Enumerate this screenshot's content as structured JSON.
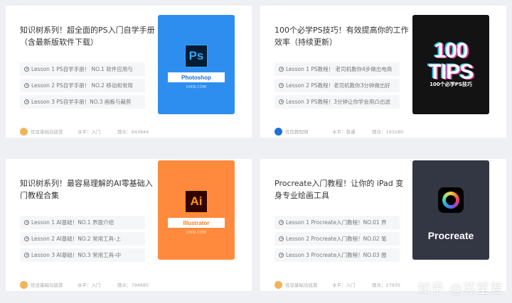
{
  "watermark": "知乎 @苏笙君",
  "colors": {
    "accent_blue": "#2e8ef0",
    "accent_orange": "#ff8a3d",
    "page_bg": "#eef0f3"
  },
  "cards": [
    {
      "title": "知识树系列！超全面的PS入门自学手册（含最新版软件下载）",
      "lessons": [
        "Lesson 1 PS自学手册！ NO.1 软件应用与",
        "Lesson 2 PS自学手册！ NO.2 移动和常用",
        "Lesson 3 PS自学手册！NO.3 画板与裁剪"
      ],
      "author": "优设基础功底营",
      "level": "水平：入门",
      "views": "观众：943844",
      "cover": {
        "brand": "Photoshop",
        "icon_text": "Ps",
        "sub": "UIKN.COM",
        "icon": "photoshop-icon"
      }
    },
    {
      "title": "100个必学PS技巧！有效提高你的工作效率（持续更新）",
      "lessons": [
        "Lesson 1 PS教程！ 老司机教你4步做出电商",
        "Lesson 2 PS教程！老司机教你3分钟做出好",
        "Lesson 3 PS教程！3分钟让你学会用凸出滤"
      ],
      "author": "优优教程网",
      "level": "水平：普通",
      "views": "观众：193280",
      "cover": {
        "big": "100 TIPS",
        "sub": "100个必学PS技巧"
      }
    },
    {
      "title": "知识树系列！最容易理解的AI零基础入门教程合集",
      "lessons": [
        "Lesson 1 AI基础！NO.1 界面介绍",
        "Lesson 2 AI基础！NO.2 常用工具-上",
        "Lesson 3 AI基础！NO.3 常用工具-中"
      ],
      "author": "优设基础功底营",
      "level": "水平：入门",
      "views": "观众：794685",
      "cover": {
        "brand": "Illustrator",
        "icon_text": "Ai",
        "sub": "UIKN.COM",
        "icon": "illustrator-icon"
      }
    },
    {
      "title": "Procreate入门教程！让你的 iPad 变身专业绘画工具",
      "lessons": [
        "Lesson 1 Procreate入门教程！NO.01 界",
        "Lesson 2 Procreate入门教程！NO.02 笔",
        "Lesson 3 Procreate入门教程！NO.03 图"
      ],
      "author": "优设基础功底营",
      "level": "水平：入门",
      "views": "观众：27935",
      "cover": {
        "brand": "Procreate",
        "icon": "procreate-icon"
      }
    }
  ]
}
